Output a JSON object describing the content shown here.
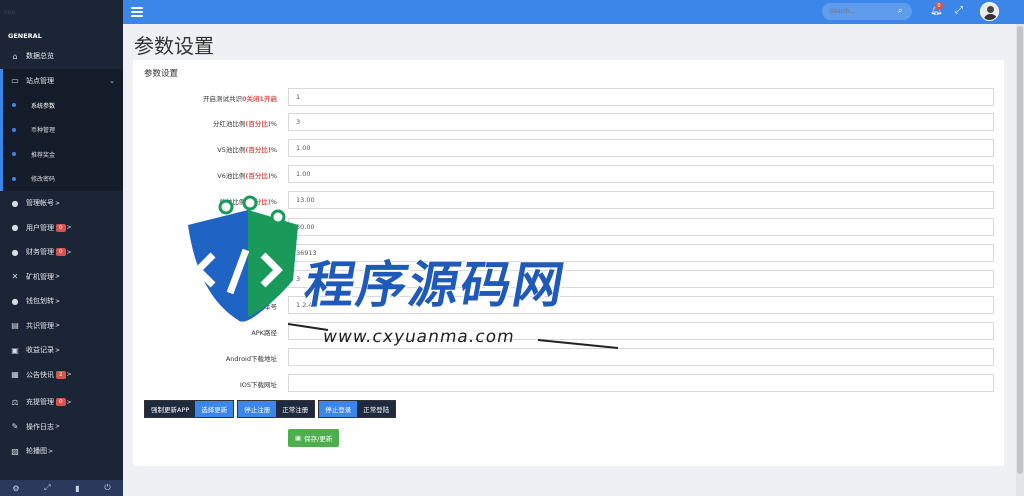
{
  "sidebar": {
    "top_text": "ooo",
    "section": "GENERAL",
    "items": [
      {
        "label": "数据总览",
        "icon": "home-icon"
      },
      {
        "label": "站点管理",
        "icon": "monitor-icon"
      },
      {
        "label": "管理帐号",
        "icon": "user-icon",
        "arrow": ">"
      },
      {
        "label": "用户管理",
        "icon": "user-icon",
        "badge": "0",
        "arrow": ">"
      },
      {
        "label": "财务管理",
        "icon": "user-icon",
        "badge": "0",
        "arrow": ">"
      },
      {
        "label": "矿机管理",
        "icon": "tools-icon",
        "arrow": ">"
      },
      {
        "label": "钱包划转",
        "icon": "user-icon",
        "arrow": ">"
      },
      {
        "label": "共识管理",
        "icon": "book-icon",
        "arrow": ">"
      },
      {
        "label": "收益记录",
        "icon": "money-icon",
        "arrow": ">"
      },
      {
        "label": "公告快讯",
        "icon": "calendar-icon",
        "badge": "2",
        "arrow": ">"
      },
      {
        "label": "充提管理",
        "icon": "scale-icon",
        "badge": "0",
        "arrow": ">"
      },
      {
        "label": "操作日志",
        "icon": "edit-icon",
        "arrow": ">"
      },
      {
        "label": "轮播图",
        "icon": "image-icon",
        "arrow": ">"
      }
    ],
    "subitems": [
      "系统参数",
      "币种管理",
      "推荐奖金",
      "修改密码"
    ]
  },
  "topbar": {
    "search_placeholder": "Search...",
    "notification_count": "0"
  },
  "page": {
    "title": "参数设置",
    "panel_title": "参数设置",
    "fields": [
      {
        "label": "开启测试共识",
        "label_red": "0关闭1开启",
        "label_suffix": "",
        "value": "1"
      },
      {
        "label": "分红池比例",
        "label_red": "(百分比)",
        "label_suffix": "%",
        "value": "3"
      },
      {
        "label": "V5池比例",
        "label_red": "(百分比)",
        "label_suffix": "%",
        "value": "1.00"
      },
      {
        "label": "V6池比例",
        "label_red": "(百分比)",
        "label_suffix": "%",
        "value": "1.00"
      },
      {
        "label": "收益比例",
        "label_red": "(百分比)",
        "label_suffix": "%",
        "value": "13.00"
      },
      {
        "label": "",
        "label_red": "",
        "label_suffix": "",
        "value": "30.00"
      },
      {
        "label": "",
        "label_red": "",
        "label_suffix": "",
        "value": "36913"
      },
      {
        "label": "",
        "label_red": "",
        "label_suffix": "",
        "value": "3"
      },
      {
        "label": "版本号",
        "label_red": "",
        "label_suffix": "",
        "value": "1.2.4"
      },
      {
        "label": "APK路径",
        "label_red": "",
        "label_suffix": "",
        "value": ""
      },
      {
        "label": "Android下载地址",
        "label_red": "",
        "label_suffix": "",
        "value": ""
      },
      {
        "label": "IOS下载网址",
        "label_red": "",
        "label_suffix": "",
        "value": ""
      }
    ],
    "buttons": {
      "force_update": "强制更新APP",
      "optional_update": "选择更新",
      "stop_register": "停止注册",
      "normal_register": "正常注册",
      "stop_login": "停止登录",
      "normal_login": "正常登陆"
    },
    "save_label": "保存/更新"
  },
  "watermark": {
    "text": "程序源码网",
    "url": "www.cxyuanma.com"
  },
  "colors": {
    "topbar": "#3b86e8",
    "sidebar": "#1c2536",
    "accent_red": "#d9534f",
    "save_green": "#4cae4c"
  }
}
